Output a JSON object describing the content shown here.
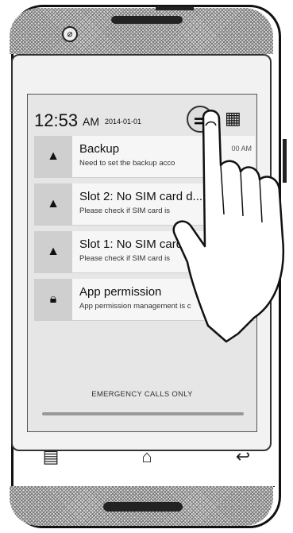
{
  "status": {
    "time": "12:53",
    "ampm": "AM",
    "date": "2014-01-01"
  },
  "controls": {
    "clear_icon": "clear-all-icon",
    "settings_icon": "quick-settings-grid-icon"
  },
  "notifications": [
    {
      "icon": "warning-icon",
      "title": "Backup",
      "subtitle": "Need to set the backup acco",
      "time": "00 AM"
    },
    {
      "icon": "warning-icon",
      "title": "Slot 2: No SIM card d...",
      "subtitle": "Please check if SIM card is",
      "time": ""
    },
    {
      "icon": "warning-icon",
      "title": "Slot 1: No SIM card d",
      "subtitle": "Please check if SIM card is",
      "time": ""
    },
    {
      "icon": "lock-icon",
      "title": "App permission",
      "subtitle": "App permission management is c",
      "time": ""
    }
  ],
  "footer": {
    "emergency": "EMERGENCY CALLS ONLY"
  }
}
